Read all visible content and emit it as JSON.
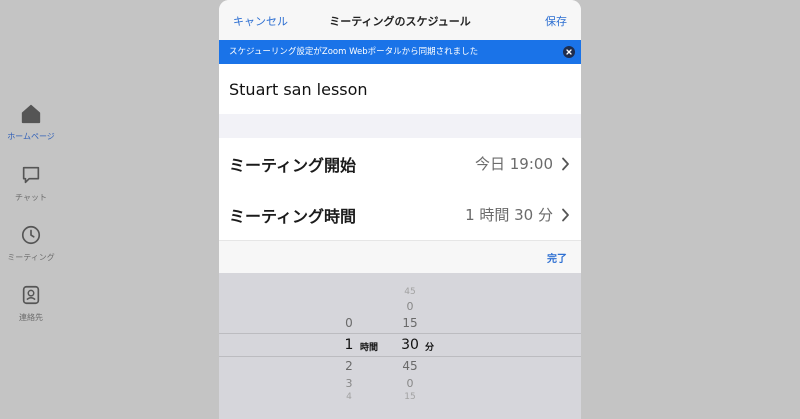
{
  "sidebar": {
    "items": [
      {
        "label": "ホームページ",
        "icon": "home-icon",
        "active": true
      },
      {
        "label": "チャット",
        "icon": "chat-bubble-icon",
        "active": false
      },
      {
        "label": "ミーティング",
        "icon": "clock-icon",
        "active": false
      },
      {
        "label": "連絡先",
        "icon": "contact-card-icon",
        "active": false
      }
    ]
  },
  "modal": {
    "cancel_label": "キャンセル",
    "title": "ミーティングのスケジュール",
    "save_label": "保存",
    "banner_text": "スケジューリング設定がZoom Webポータルから同期されました",
    "topic_value": "Stuart san lesson",
    "rows": {
      "start": {
        "label": "ミーティング開始",
        "value": "今日 19:00"
      },
      "duration": {
        "label": "ミーティング時間",
        "value": "1 時間 30 分"
      }
    },
    "done_label": "完了"
  },
  "picker": {
    "hours": {
      "above": [
        "0"
      ],
      "selected": "1",
      "below": [
        "2",
        "3",
        "4"
      ],
      "unit": "時間"
    },
    "minutes": {
      "above": [
        "45",
        "0",
        "15"
      ],
      "selected": "30",
      "below": [
        "45",
        "0",
        "15"
      ],
      "unit": "分"
    }
  },
  "colors": {
    "accent": "#2d6fd2",
    "banner": "#1a73e8",
    "overlay": "#c4c4c4"
  }
}
